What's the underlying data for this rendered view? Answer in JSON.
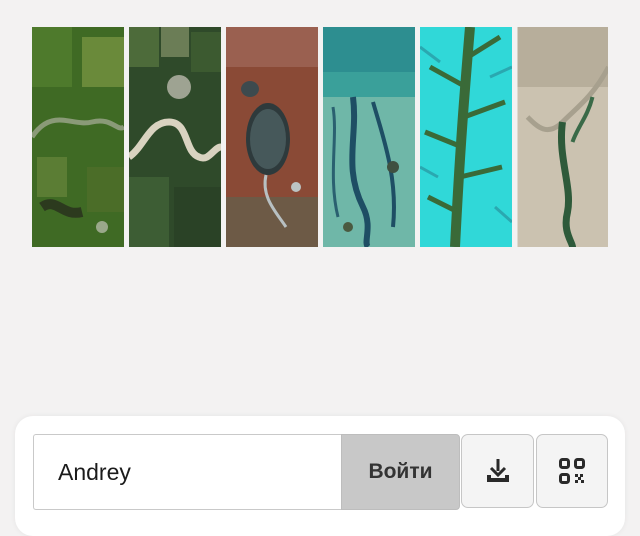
{
  "gallery": {
    "tiles": [
      {
        "icon": "satellite-river-farmland-image"
      },
      {
        "icon": "satellite-river-meander-image"
      },
      {
        "icon": "satellite-lake-red-terrain-image"
      },
      {
        "icon": "satellite-delta-turquoise-image"
      },
      {
        "icon": "satellite-cyan-dendritic-image"
      },
      {
        "icon": "satellite-desert-river-image"
      }
    ]
  },
  "login": {
    "name_value": "Andrey",
    "button_label": "Войти"
  },
  "actions": {
    "download_icon": "download-icon",
    "qr_icon": "qr-code-icon"
  },
  "colors": {
    "background": "#f3f2f2",
    "panel": "#ffffff",
    "button_gray": "#c8c8c8"
  }
}
